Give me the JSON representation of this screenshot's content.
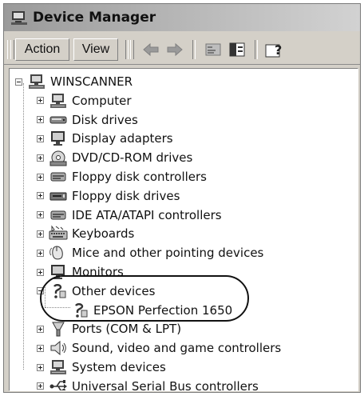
{
  "window": {
    "title": "Device Manager",
    "title_icon": "device-manager-icon"
  },
  "toolbar": {
    "action_label": "Action",
    "view_label": "View",
    "icons": [
      "back-arrow-icon",
      "forward-arrow-icon",
      "properties-icon",
      "show-hide-console-tree-icon",
      "help-icon"
    ]
  },
  "tree": {
    "root": {
      "label": "WINSCANNER",
      "icon": "computer-icon",
      "expanded": true
    },
    "items": [
      {
        "label": "Computer",
        "icon": "computer-icon",
        "expanded": false
      },
      {
        "label": "Disk drives",
        "icon": "disk-drive-icon",
        "expanded": false
      },
      {
        "label": "Display adapters",
        "icon": "monitor-icon",
        "expanded": false
      },
      {
        "label": "DVD/CD-ROM drives",
        "icon": "cd-rom-icon",
        "expanded": false
      },
      {
        "label": "Floppy disk controllers",
        "icon": "controller-icon",
        "expanded": false
      },
      {
        "label": "Floppy disk drives",
        "icon": "floppy-drive-icon",
        "expanded": false
      },
      {
        "label": "IDE ATA/ATAPI controllers",
        "icon": "controller-icon",
        "expanded": false
      },
      {
        "label": "Keyboards",
        "icon": "keyboard-icon",
        "expanded": false
      },
      {
        "label": "Mice and other pointing devices",
        "icon": "mouse-icon",
        "expanded": false
      },
      {
        "label": "Monitors",
        "icon": "monitor-icon",
        "expanded": false
      },
      {
        "label": "Other devices",
        "icon": "unknown-device-icon",
        "expanded": true,
        "children": [
          {
            "label": "EPSON Perfection 1650",
            "icon": "unknown-device-icon"
          }
        ]
      },
      {
        "label": "Ports (COM & LPT)",
        "icon": "port-icon",
        "expanded": false
      },
      {
        "label": "Sound, video and game controllers",
        "icon": "speaker-icon",
        "expanded": false
      },
      {
        "label": "System devices",
        "icon": "computer-icon",
        "expanded": false
      },
      {
        "label": "Universal Serial Bus controllers",
        "icon": "usb-icon",
        "expanded": false
      }
    ]
  }
}
